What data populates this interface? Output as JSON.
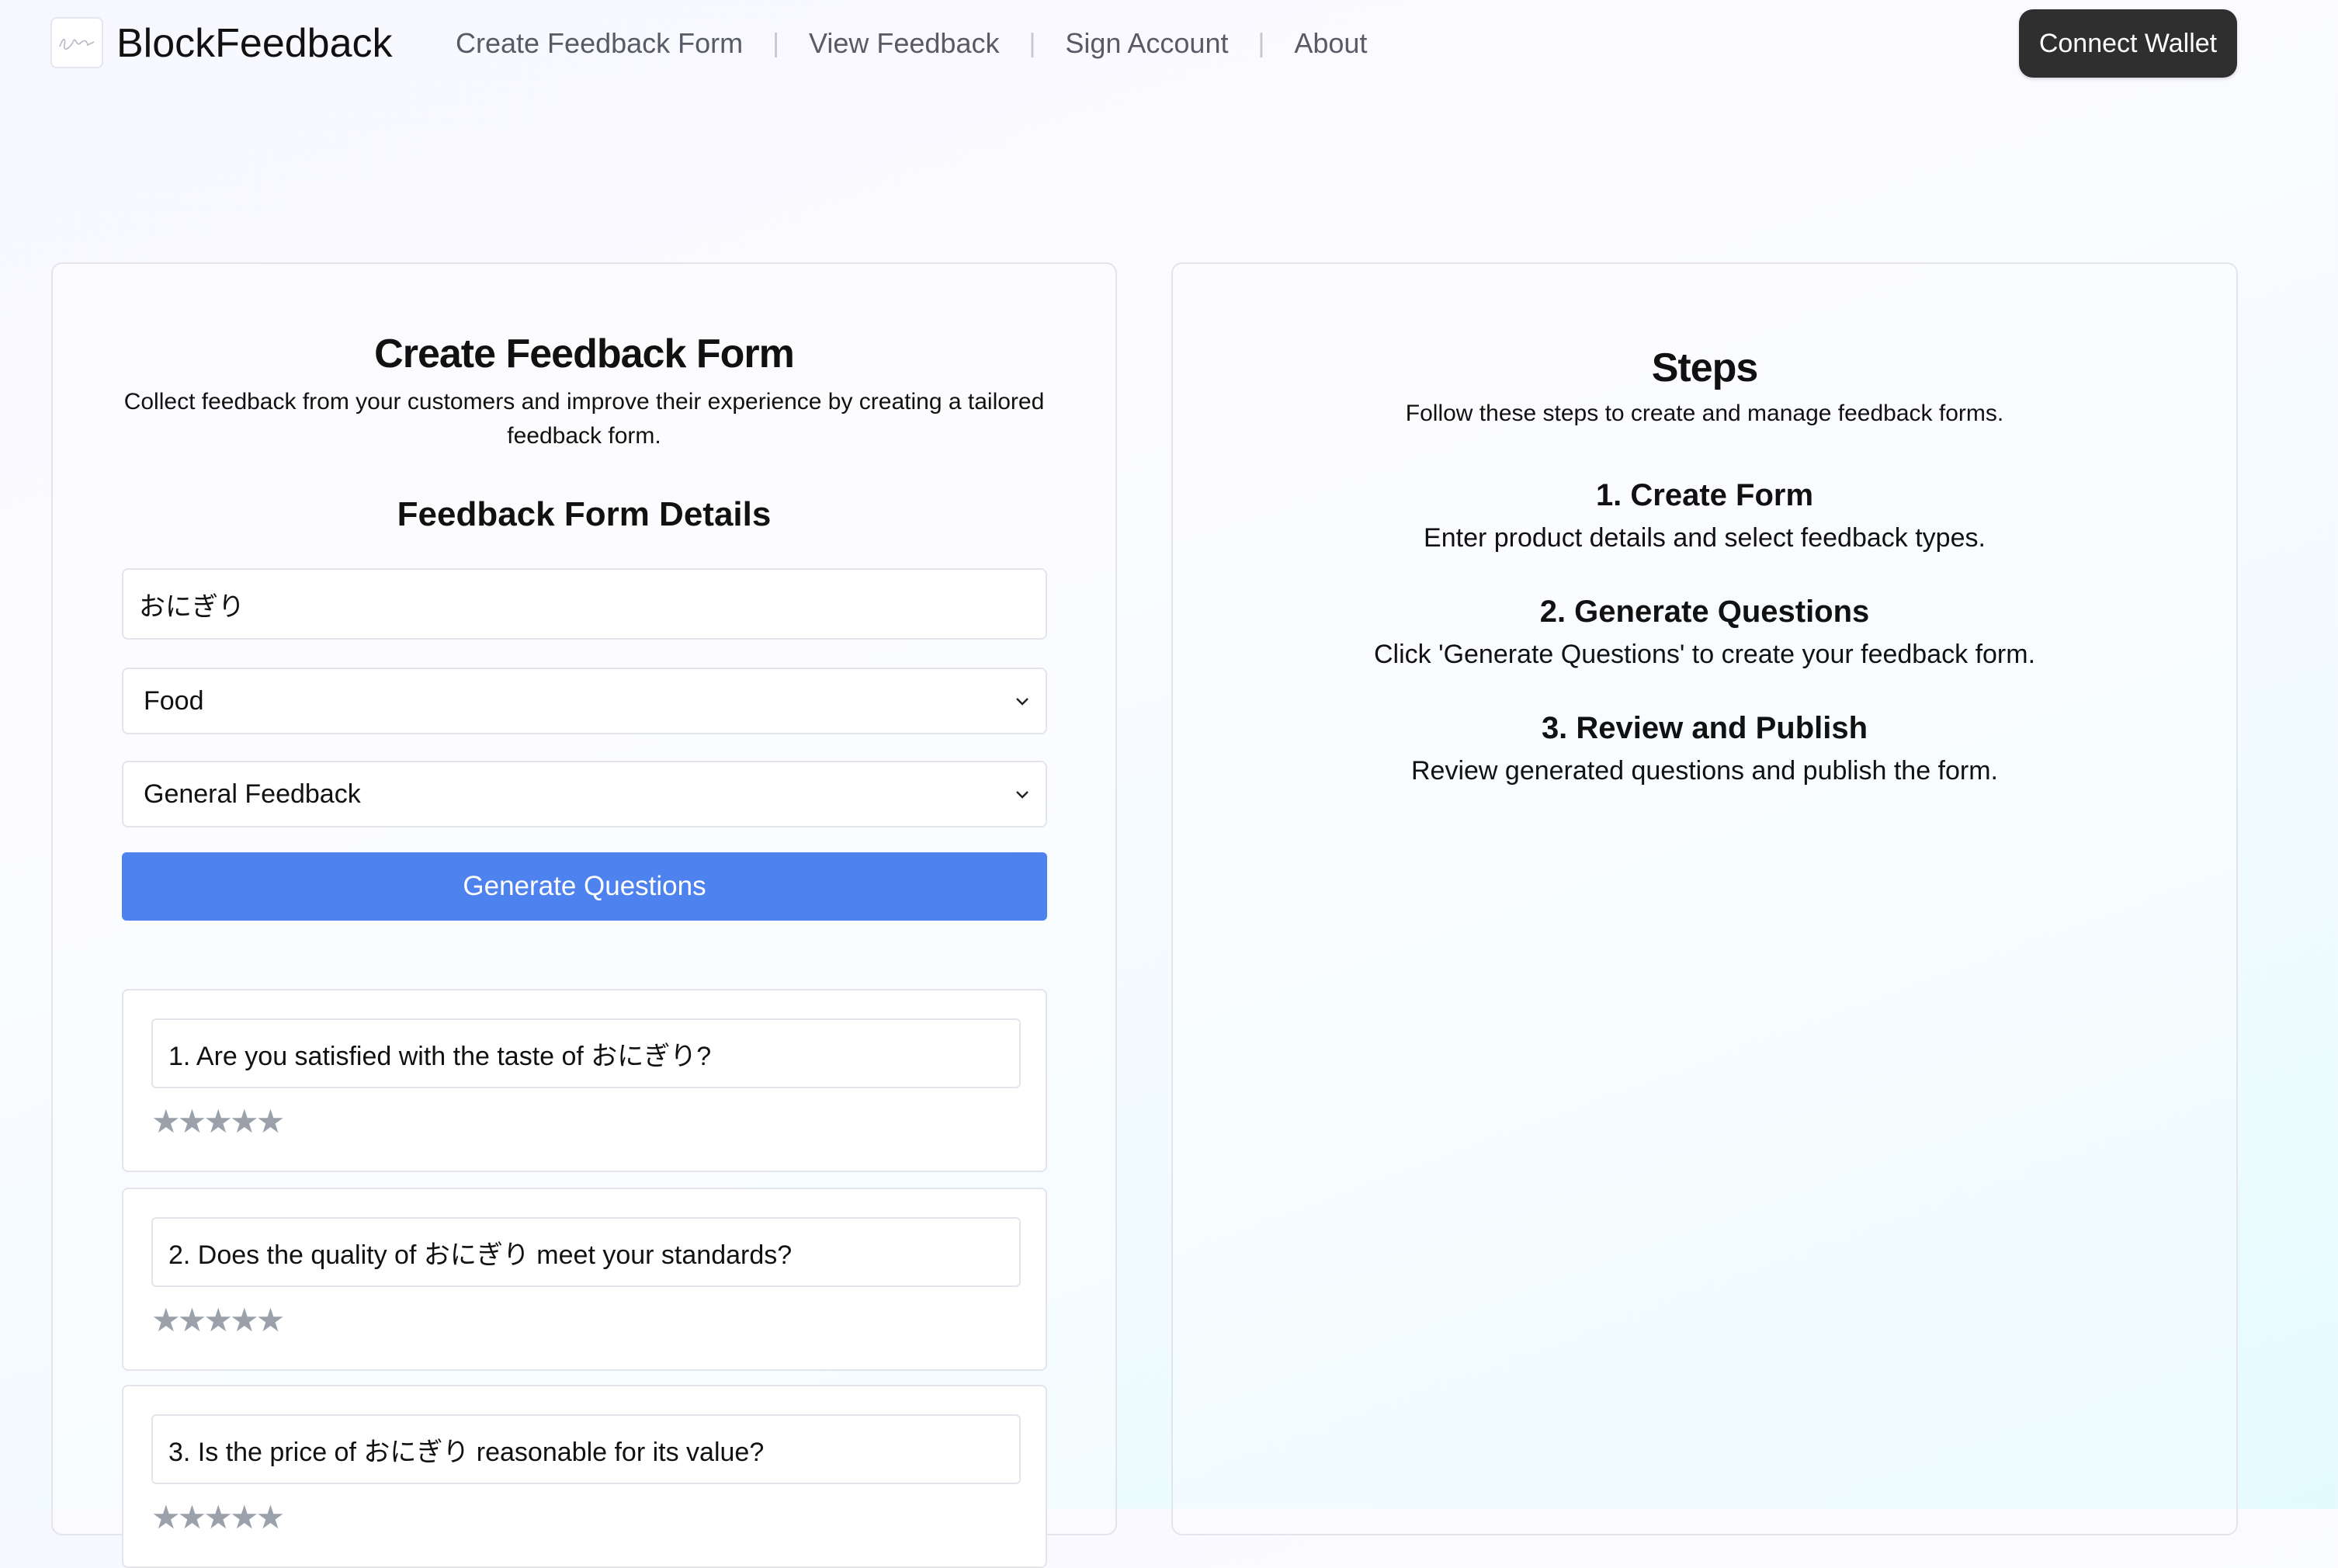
{
  "header": {
    "brand": "BlockFeedback",
    "logo_icon": "signature-logo-icon",
    "nav": [
      {
        "label": "Create Feedback Form"
      },
      {
        "label": "View Feedback"
      },
      {
        "label": "Sign Account"
      },
      {
        "label": "About"
      }
    ],
    "nav_separator": "|",
    "connect_wallet": "Connect Wallet"
  },
  "form": {
    "title": "Create Feedback Form",
    "subtitle": "Collect feedback from your customers and improve their experience by creating a tailored feedback form.",
    "details_title": "Feedback Form Details",
    "product_name_value": "おにぎり",
    "category_value": "Food",
    "feedback_type_value": "General Feedback",
    "generate_button": "Generate Questions",
    "questions": [
      {
        "text": "1. Are you satisfied with the taste of おにぎり?",
        "rating": 0,
        "max_rating": 5
      },
      {
        "text": "2. Does the quality of おにぎり meet your standards?",
        "rating": 0,
        "max_rating": 5
      },
      {
        "text": "3. Is the price of おにぎり reasonable for its value?",
        "rating": 0,
        "max_rating": 5
      }
    ],
    "star_glyph": "★",
    "colors": {
      "button": "#4e82ee",
      "star_inactive": "#9aa1ab"
    }
  },
  "steps": {
    "title": "Steps",
    "subtitle": "Follow these steps to create and manage feedback forms.",
    "items": [
      {
        "title": "1. Create Form",
        "desc": "Enter product details and select feedback types."
      },
      {
        "title": "2. Generate Questions",
        "desc": "Click 'Generate Questions' to create your feedback form."
      },
      {
        "title": "3. Review and Publish",
        "desc": "Review generated questions and publish the form."
      }
    ]
  }
}
